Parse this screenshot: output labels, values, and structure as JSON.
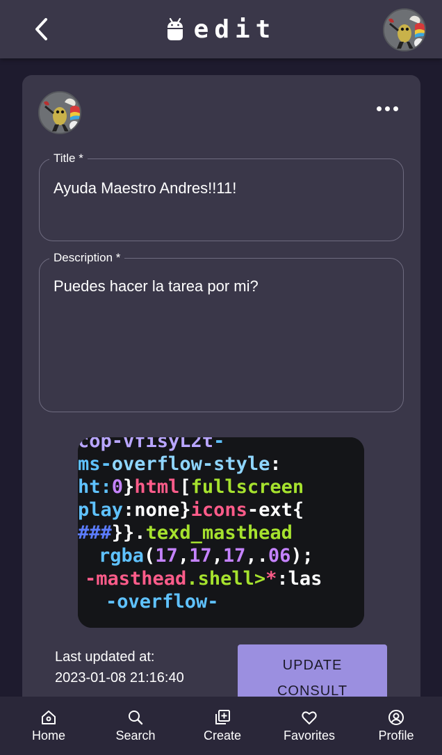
{
  "app_bar": {
    "title": "edit",
    "back_icon": "chevron-left-icon",
    "logo_icon": "android-icon",
    "avatar_icon": "user-avatar"
  },
  "card": {
    "author_avatar": "user-avatar",
    "more_icon": "more-horizontal-icon",
    "title_field": {
      "label": "Title *",
      "value": "Ayuda Maestro Andres!!11!"
    },
    "description_field": {
      "label": "Description *",
      "value": "Puedes hacer la tarea por mi?"
    },
    "image_lines": [
      {
        "parts": [
          {
            "t": "cop-vfisyL2t",
            "c": "#b9a6ff"
          },
          {
            "t": "-",
            "c": "#5fc2ff"
          }
        ]
      },
      {
        "parts": [
          {
            "t": "ms-",
            "c": "#5fc2ff"
          },
          {
            "t": "overflow-style",
            "c": "#8fd6ff"
          },
          {
            "t": ":",
            "c": "#ffffff"
          }
        ]
      },
      {
        "parts": [
          {
            "t": "ht:",
            "c": "#5fc2ff"
          },
          {
            "t": "0",
            "c": "#c583ff"
          },
          {
            "t": "}",
            "c": "#ffffff"
          },
          {
            "t": "html",
            "c": "#ff5c8a"
          },
          {
            "t": "[",
            "c": "#ffffff"
          },
          {
            "t": "fullscreen",
            "c": "#a6e22e"
          }
        ]
      },
      {
        "parts": [
          {
            "t": "play",
            "c": "#5fc2ff"
          },
          {
            "t": ":none}",
            "c": "#ffffff"
          },
          {
            "t": "icons",
            "c": "#ff5c8a"
          },
          {
            "t": "-ext{",
            "c": "#ffffff"
          }
        ]
      },
      {
        "parts": [
          {
            "t": "###",
            "c": "#5b7cff"
          },
          {
            "t": "}}.",
            "c": "#ffffff"
          },
          {
            "t": "texd_masthead",
            "c": "#a6e22e"
          }
        ]
      },
      {
        "parts": [
          {
            "t": " rgba",
            "c": "#5fc2ff"
          },
          {
            "t": "(",
            "c": "#ffffff"
          },
          {
            "t": "17",
            "c": "#c583ff"
          },
          {
            "t": ",",
            "c": "#ffffff"
          },
          {
            "t": "17",
            "c": "#c583ff"
          },
          {
            "t": ",",
            "c": "#ffffff"
          },
          {
            "t": "17",
            "c": "#c583ff"
          },
          {
            "t": ",.",
            "c": "#ffffff"
          },
          {
            "t": "06",
            "c": "#c583ff"
          },
          {
            "t": ");",
            "c": "#ffffff"
          }
        ]
      },
      {
        "parts": [
          {
            "t": "-masthead",
            "c": "#ff5c8a"
          },
          {
            "t": ".shell>",
            "c": "#a6e22e"
          },
          {
            "t": "*",
            "c": "#ff5c8a"
          },
          {
            "t": ":las",
            "c": "#ffffff"
          }
        ]
      },
      {
        "parts": [
          {
            "t": "-overflow-",
            "c": "#5fc2ff"
          }
        ]
      }
    ],
    "last_updated_label": "Last updated at:",
    "last_updated_value": "2023-01-08 21:16:40",
    "update_button_line1": "UPDATE",
    "update_button_line2": "CONSULT"
  },
  "bottom_nav": {
    "items": [
      {
        "label": "Home",
        "icon": "home-icon"
      },
      {
        "label": "Search",
        "icon": "search-icon"
      },
      {
        "label": "Create",
        "icon": "add-box-icon"
      },
      {
        "label": "Favorites",
        "icon": "heart-icon"
      },
      {
        "label": "Profile",
        "icon": "account-circle-icon"
      }
    ]
  },
  "colors": {
    "background": "#1e1b2e",
    "surface": "#3a3749",
    "accent_button": "#9b8fe0",
    "nav_bar": "#2a2739"
  }
}
